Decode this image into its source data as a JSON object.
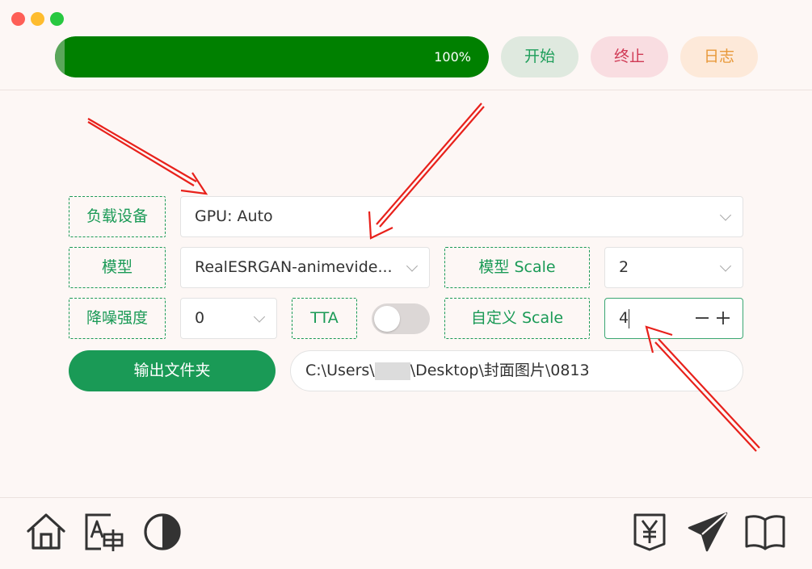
{
  "window": {
    "traffic_lights": [
      "close",
      "minimize",
      "maximize"
    ],
    "colors": {
      "close": "#fe5f57",
      "minimize": "#febc2e",
      "maximize": "#28c840"
    }
  },
  "toolbar": {
    "progress": {
      "value": 1.0,
      "label": "100%",
      "color": "#008000"
    },
    "start_label": "开始",
    "stop_label": "终止",
    "log_label": "日志"
  },
  "form": {
    "device": {
      "label": "负载设备",
      "value": "GPU: Auto"
    },
    "model": {
      "label": "模型",
      "value": "RealESRGAN-animevide..."
    },
    "model_scale": {
      "label": "模型 Scale",
      "value": "2"
    },
    "denoise": {
      "label": "降噪强度",
      "value": "0"
    },
    "tta": {
      "label": "TTA",
      "enabled": false
    },
    "custom_scale": {
      "label": "自定义 Scale",
      "value": "4"
    },
    "output": {
      "button_label": "输出文件夹",
      "path_prefix": "C:\\Users\\",
      "path_suffix": "\\Desktop\\封面图片\\0813"
    }
  },
  "bottom_bar": {
    "left_icons": [
      "home-icon",
      "translate-icon",
      "contrast-icon"
    ],
    "right_icons": [
      "yen-icon",
      "send-icon",
      "book-icon"
    ]
  },
  "accent": "#1a9a56",
  "annotation_color": "#e8211b"
}
